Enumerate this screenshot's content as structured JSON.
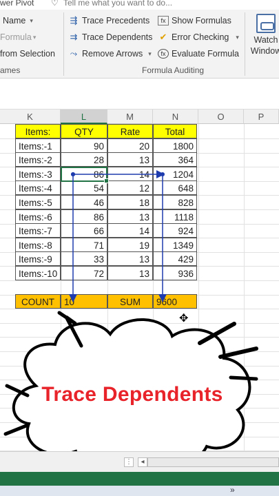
{
  "ribbon": {
    "top_left_text": "wer Pivot",
    "tell_me": "Tell me what you want to do...",
    "name_btn": "Name",
    "formula_btn": "Formula",
    "from_selection": "from Selection",
    "names_group": "ames",
    "trace_precedents": "Trace Precedents",
    "trace_dependents": "Trace Dependents",
    "remove_arrows": "Remove Arrows",
    "show_formulas": "Show Formulas",
    "error_checking": "Error Checking",
    "evaluate_formula": "Evaluate Formula",
    "formula_auditing_group": "Formula Auditing",
    "watch_line1": "Watch",
    "watch_line2": "Window"
  },
  "columns": [
    "K",
    "L",
    "M",
    "N",
    "O",
    "P"
  ],
  "table": {
    "headers": [
      "Items:",
      "QTY",
      "Rate",
      "Total"
    ],
    "rows": [
      [
        "Items:-1",
        "90",
        "20",
        "1800"
      ],
      [
        "Items:-2",
        "28",
        "13",
        "364"
      ],
      [
        "Items:-3",
        "86",
        "14",
        "1204"
      ],
      [
        "Items:-4",
        "54",
        "12",
        "648"
      ],
      [
        "Items:-5",
        "46",
        "18",
        "828"
      ],
      [
        "Items:-6",
        "86",
        "13",
        "1118"
      ],
      [
        "Items:-7",
        "66",
        "14",
        "924"
      ],
      [
        "Items:-8",
        "71",
        "19",
        "1349"
      ],
      [
        "Items:-9",
        "33",
        "13",
        "429"
      ],
      [
        "Items:-10",
        "72",
        "13",
        "936"
      ]
    ],
    "summary": [
      "COUNT",
      "10",
      "SUM",
      "9600"
    ]
  },
  "overlay_caption": "Trace Dependents",
  "colors": {
    "header_fill": "#ffff00",
    "summary_fill": "#ffc000",
    "arrow": "#1f3cae",
    "caption": "#e8232a",
    "excel_green": "#217346"
  }
}
